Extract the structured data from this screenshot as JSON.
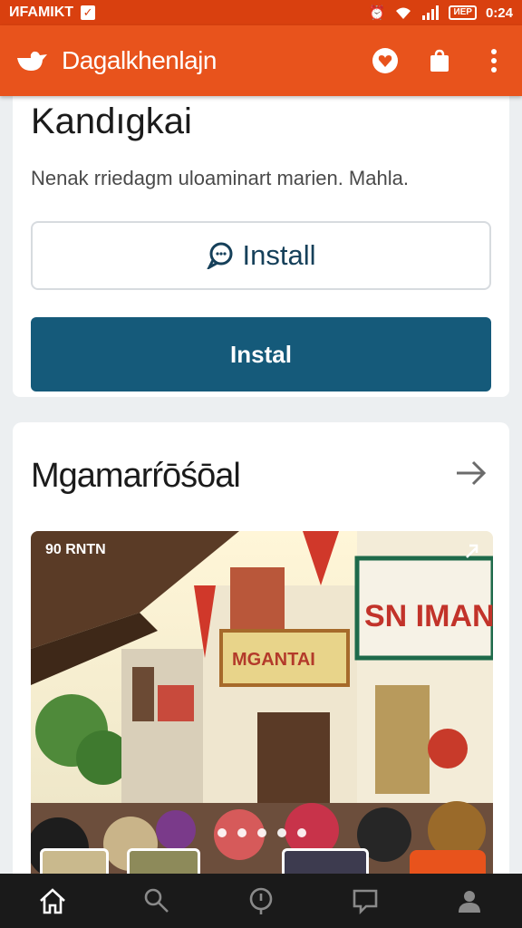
{
  "statusbar": {
    "carrier": "ИFAMIKT",
    "battery": "ИEP",
    "time": "0:24"
  },
  "appbar": {
    "title": "Dagalkhenlajn",
    "accent": "#e8531c"
  },
  "card1": {
    "title": "Kandıgkai",
    "description": "Nenak rriedagm uloaminart marien. Mahla.",
    "install_outline_label": "Install",
    "install_solid_label": "Instal"
  },
  "card2": {
    "title": "Mgamarŕōśōal",
    "photo_label": "90 RNTN",
    "carousel_dots": 5
  },
  "icons": {
    "appbar": [
      "heart-icon",
      "bag-icon",
      "more-vert-icon"
    ],
    "bottomnav": [
      "home-icon",
      "search-icon",
      "explore-icon",
      "chat-icon",
      "profile-icon"
    ]
  }
}
